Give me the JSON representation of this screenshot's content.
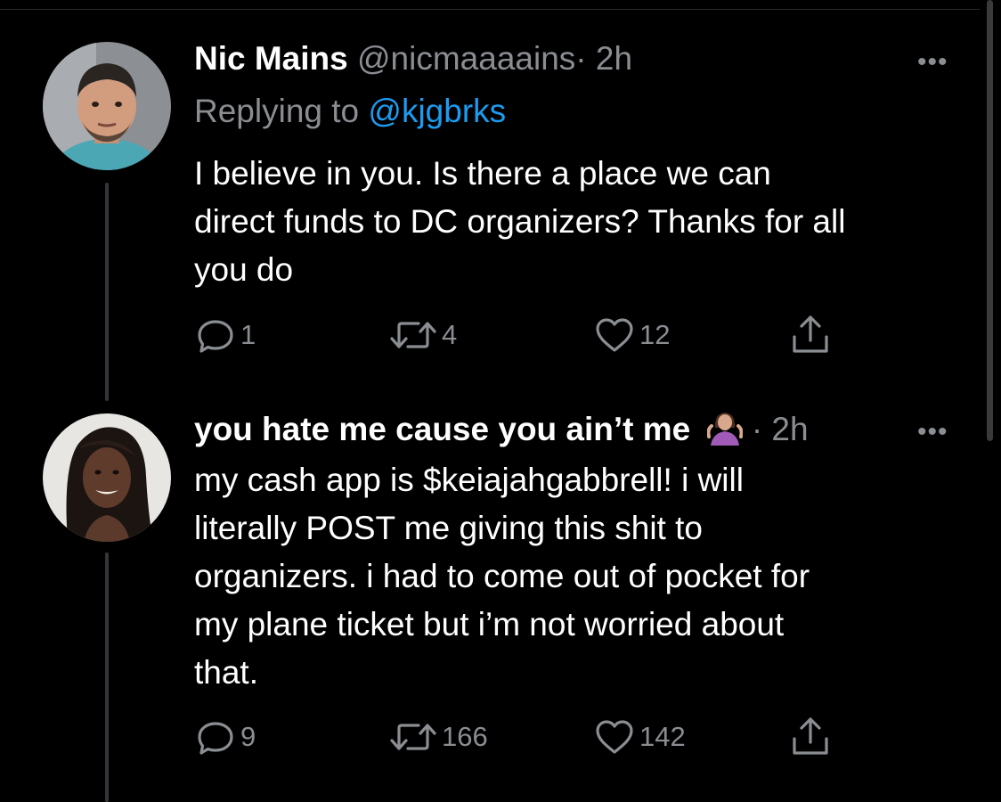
{
  "tweets": [
    {
      "display_name": "Nic Mains",
      "handle": "@nicmaaaains",
      "separator": "·",
      "time": "2h",
      "more_label": "•••",
      "replying_prefix": "Replying to ",
      "replying_handle": "@kjgbrks",
      "text": "I believe in you. Is there a place we can\ndirect funds to DC organizers? Thanks for all\nyou do",
      "replies": "1",
      "retweets": "4",
      "likes": "12",
      "avatar_icon": "avatar-photo-man"
    },
    {
      "display_name": "you hate me cause you ain’t me",
      "display_name_emoji_icon": "person-shrugging-emoji-icon",
      "separator": "·",
      "time": "2h",
      "more_label": "•••",
      "text": "my cash app is $keiajahgabbrell! i will\nliterally POST me giving this shit to\norganizers. i had to come out of pocket for\nmy plane ticket but i’m not worried about\nthat.",
      "replies": "9",
      "retweets": "166",
      "likes": "142",
      "avatar_icon": "avatar-photo-woman"
    }
  ],
  "colors": {
    "background": "#000000",
    "primary_text": "#ffffff",
    "secondary_text": "#8a8d91",
    "link": "#1d9bf0",
    "thread_line": "#333639"
  }
}
